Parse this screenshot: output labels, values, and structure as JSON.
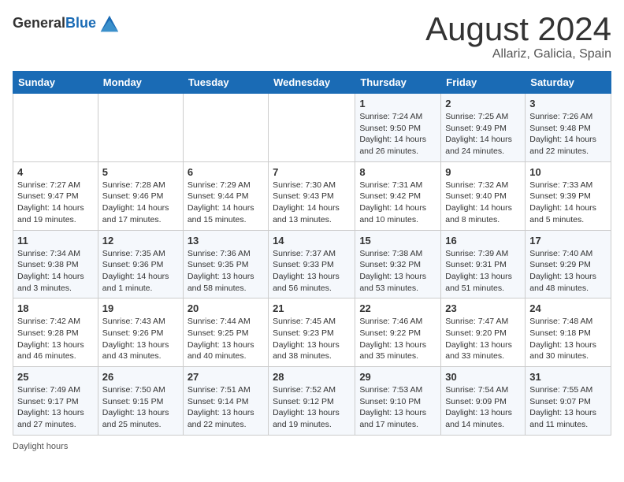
{
  "header": {
    "logo_general": "General",
    "logo_blue": "Blue",
    "month_title": "August 2024",
    "location": "Allariz, Galicia, Spain"
  },
  "days_of_week": [
    "Sunday",
    "Monday",
    "Tuesday",
    "Wednesday",
    "Thursday",
    "Friday",
    "Saturday"
  ],
  "weeks": [
    [
      {
        "day": "",
        "info": ""
      },
      {
        "day": "",
        "info": ""
      },
      {
        "day": "",
        "info": ""
      },
      {
        "day": "",
        "info": ""
      },
      {
        "day": "1",
        "info": "Sunrise: 7:24 AM\nSunset: 9:50 PM\nDaylight: 14 hours and 26 minutes."
      },
      {
        "day": "2",
        "info": "Sunrise: 7:25 AM\nSunset: 9:49 PM\nDaylight: 14 hours and 24 minutes."
      },
      {
        "day": "3",
        "info": "Sunrise: 7:26 AM\nSunset: 9:48 PM\nDaylight: 14 hours and 22 minutes."
      }
    ],
    [
      {
        "day": "4",
        "info": "Sunrise: 7:27 AM\nSunset: 9:47 PM\nDaylight: 14 hours and 19 minutes."
      },
      {
        "day": "5",
        "info": "Sunrise: 7:28 AM\nSunset: 9:46 PM\nDaylight: 14 hours and 17 minutes."
      },
      {
        "day": "6",
        "info": "Sunrise: 7:29 AM\nSunset: 9:44 PM\nDaylight: 14 hours and 15 minutes."
      },
      {
        "day": "7",
        "info": "Sunrise: 7:30 AM\nSunset: 9:43 PM\nDaylight: 14 hours and 13 minutes."
      },
      {
        "day": "8",
        "info": "Sunrise: 7:31 AM\nSunset: 9:42 PM\nDaylight: 14 hours and 10 minutes."
      },
      {
        "day": "9",
        "info": "Sunrise: 7:32 AM\nSunset: 9:40 PM\nDaylight: 14 hours and 8 minutes."
      },
      {
        "day": "10",
        "info": "Sunrise: 7:33 AM\nSunset: 9:39 PM\nDaylight: 14 hours and 5 minutes."
      }
    ],
    [
      {
        "day": "11",
        "info": "Sunrise: 7:34 AM\nSunset: 9:38 PM\nDaylight: 14 hours and 3 minutes."
      },
      {
        "day": "12",
        "info": "Sunrise: 7:35 AM\nSunset: 9:36 PM\nDaylight: 14 hours and 1 minute."
      },
      {
        "day": "13",
        "info": "Sunrise: 7:36 AM\nSunset: 9:35 PM\nDaylight: 13 hours and 58 minutes."
      },
      {
        "day": "14",
        "info": "Sunrise: 7:37 AM\nSunset: 9:33 PM\nDaylight: 13 hours and 56 minutes."
      },
      {
        "day": "15",
        "info": "Sunrise: 7:38 AM\nSunset: 9:32 PM\nDaylight: 13 hours and 53 minutes."
      },
      {
        "day": "16",
        "info": "Sunrise: 7:39 AM\nSunset: 9:31 PM\nDaylight: 13 hours and 51 minutes."
      },
      {
        "day": "17",
        "info": "Sunrise: 7:40 AM\nSunset: 9:29 PM\nDaylight: 13 hours and 48 minutes."
      }
    ],
    [
      {
        "day": "18",
        "info": "Sunrise: 7:42 AM\nSunset: 9:28 PM\nDaylight: 13 hours and 46 minutes."
      },
      {
        "day": "19",
        "info": "Sunrise: 7:43 AM\nSunset: 9:26 PM\nDaylight: 13 hours and 43 minutes."
      },
      {
        "day": "20",
        "info": "Sunrise: 7:44 AM\nSunset: 9:25 PM\nDaylight: 13 hours and 40 minutes."
      },
      {
        "day": "21",
        "info": "Sunrise: 7:45 AM\nSunset: 9:23 PM\nDaylight: 13 hours and 38 minutes."
      },
      {
        "day": "22",
        "info": "Sunrise: 7:46 AM\nSunset: 9:22 PM\nDaylight: 13 hours and 35 minutes."
      },
      {
        "day": "23",
        "info": "Sunrise: 7:47 AM\nSunset: 9:20 PM\nDaylight: 13 hours and 33 minutes."
      },
      {
        "day": "24",
        "info": "Sunrise: 7:48 AM\nSunset: 9:18 PM\nDaylight: 13 hours and 30 minutes."
      }
    ],
    [
      {
        "day": "25",
        "info": "Sunrise: 7:49 AM\nSunset: 9:17 PM\nDaylight: 13 hours and 27 minutes."
      },
      {
        "day": "26",
        "info": "Sunrise: 7:50 AM\nSunset: 9:15 PM\nDaylight: 13 hours and 25 minutes."
      },
      {
        "day": "27",
        "info": "Sunrise: 7:51 AM\nSunset: 9:14 PM\nDaylight: 13 hours and 22 minutes."
      },
      {
        "day": "28",
        "info": "Sunrise: 7:52 AM\nSunset: 9:12 PM\nDaylight: 13 hours and 19 minutes."
      },
      {
        "day": "29",
        "info": "Sunrise: 7:53 AM\nSunset: 9:10 PM\nDaylight: 13 hours and 17 minutes."
      },
      {
        "day": "30",
        "info": "Sunrise: 7:54 AM\nSunset: 9:09 PM\nDaylight: 13 hours and 14 minutes."
      },
      {
        "day": "31",
        "info": "Sunrise: 7:55 AM\nSunset: 9:07 PM\nDaylight: 13 hours and 11 minutes."
      }
    ]
  ],
  "footer": {
    "label": "Daylight hours"
  }
}
